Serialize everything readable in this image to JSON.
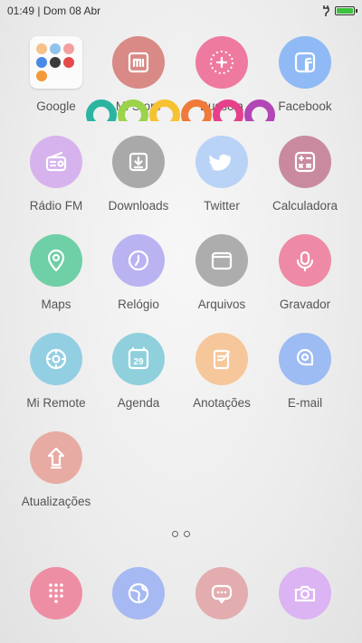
{
  "status": {
    "time_date": "01:49 | Dom 08 Abr",
    "battery_level_percent": 100,
    "battery_color": "#3cc23c"
  },
  "apps": [
    {
      "label": "Google",
      "icon": "folder-icon"
    },
    {
      "label": "Mi Store",
      "icon": "mi-store-icon",
      "color": "#d98a86"
    },
    {
      "label": "Bussola",
      "icon": "compass-icon",
      "color": "#ee7aa0"
    },
    {
      "label": "Facebook",
      "icon": "facebook-icon",
      "color": "#8fbaf5"
    },
    {
      "label": "Rádio FM",
      "icon": "radio-icon",
      "color": "#d7b3ee"
    },
    {
      "label": "Downloads",
      "icon": "download-icon",
      "color": "#a9a9a9"
    },
    {
      "label": "Twitter",
      "icon": "twitter-icon",
      "color": "#b9d3f7"
    },
    {
      "label": "Calculadora",
      "icon": "calculator-icon",
      "color": "#c98aa0"
    },
    {
      "label": "Maps",
      "icon": "map-pin-icon",
      "color": "#6fcfa6"
    },
    {
      "label": "Relógio",
      "icon": "clock-icon",
      "color": "#b9b3f2"
    },
    {
      "label": "Arquivos",
      "icon": "folder-files-icon",
      "color": "#adadad"
    },
    {
      "label": "Gravador",
      "icon": "microphone-icon",
      "color": "#ee8aa6"
    },
    {
      "label": "Mi Remote",
      "icon": "remote-icon",
      "color": "#93cfe3"
    },
    {
      "label": "Agenda",
      "icon": "calendar-icon",
      "color": "#8fd0dc",
      "day": "29"
    },
    {
      "label": "Anotações",
      "icon": "notes-icon",
      "color": "#f6c79b"
    },
    {
      "label": "E-mail",
      "icon": "email-icon",
      "color": "#9dbcf3"
    },
    {
      "label": "Atualizações",
      "icon": "update-arrow-icon",
      "color": "#e7aba4"
    }
  ],
  "dock": [
    {
      "icon": "dialer-icon",
      "color": "#ee8ea4"
    },
    {
      "icon": "browser-globe-icon",
      "color": "#a7b9f3"
    },
    {
      "icon": "messages-icon",
      "color": "#e3adb0"
    },
    {
      "icon": "camera-icon",
      "color": "#dcb3f3"
    }
  ],
  "page_indicator": {
    "pages": 2,
    "current": 1
  },
  "folder_mini_colors": [
    "#f6c28a",
    "#8fc3ea",
    "#f3a0a0",
    "#4a8ae6",
    "#3a3a3a",
    "#e44a4a",
    "#f39a3a"
  ],
  "rainbow_colors": [
    "#2bb5a0",
    "#9bd34a",
    "#f6c232",
    "#f07a3a",
    "#e6408a",
    "#b246b6"
  ]
}
